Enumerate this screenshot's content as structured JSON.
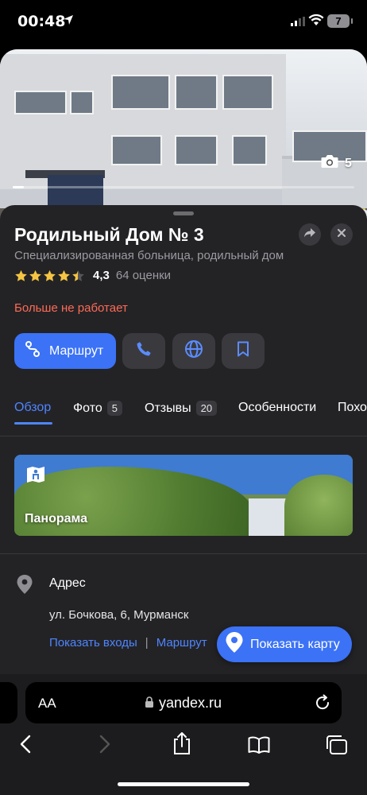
{
  "status_bar": {
    "time": "00:48",
    "battery": "7"
  },
  "photo": {
    "count": "5"
  },
  "place": {
    "title": "Родильный Дом № 3",
    "subtitle": "Специализированная больница, родильный дом",
    "rating_value": "4,3",
    "rating_stars": 4.3,
    "reviews": "64 оценки",
    "status": "Больше не работает"
  },
  "actions": {
    "route_label": "Маршрут"
  },
  "tabs": [
    {
      "label": "Обзор",
      "badge": ""
    },
    {
      "label": "Фото",
      "badge": "5"
    },
    {
      "label": "Отзывы",
      "badge": "20"
    },
    {
      "label": "Особенности",
      "badge": ""
    },
    {
      "label": "Похо",
      "badge": ""
    }
  ],
  "panorama": {
    "label": "Панорама"
  },
  "address": {
    "label": "Адрес",
    "value": "ул. Бочкова, 6, Мурманск",
    "link_entrances": "Показать входы",
    "separator": "|",
    "link_route": "Маршрут"
  },
  "map_button": {
    "label": "Показать карту"
  },
  "browser": {
    "text_size": "AA",
    "url": "yandex.ru"
  },
  "colors": {
    "accent": "#3b72f6",
    "closed": "#ff6a55",
    "star": "#f5c443",
    "sheet": "#232326"
  }
}
